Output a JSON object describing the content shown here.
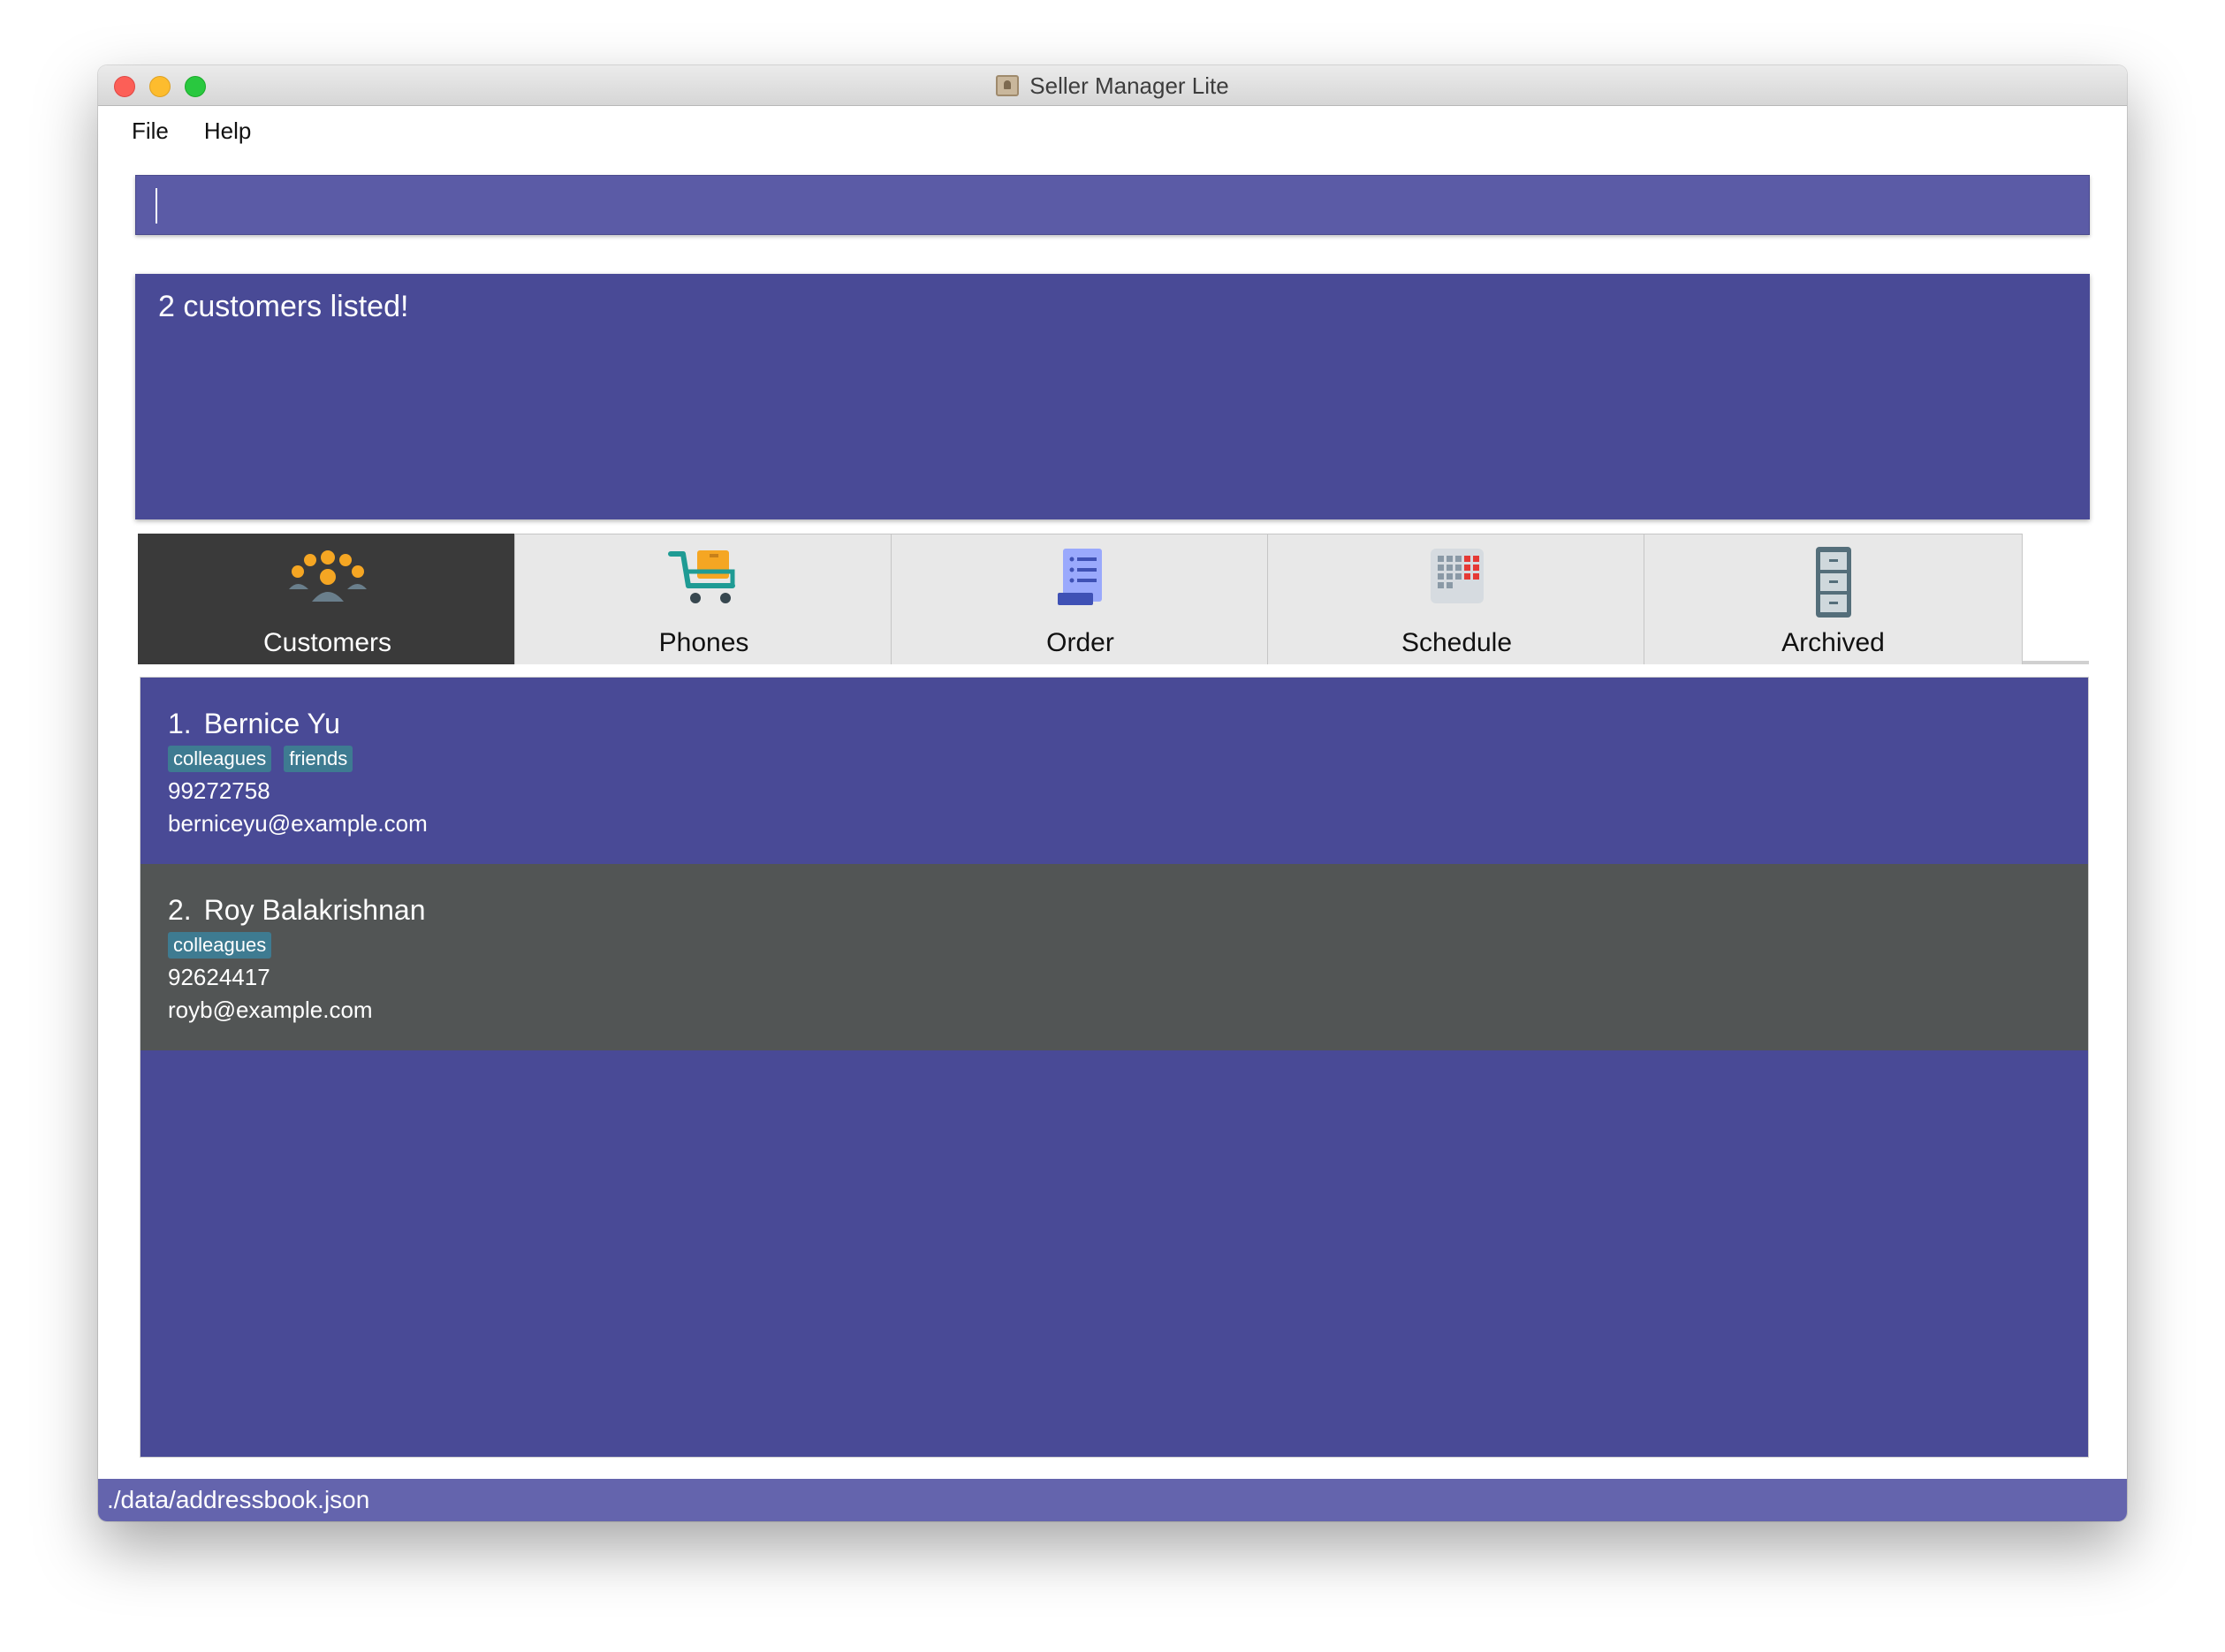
{
  "window": {
    "title": "Seller Manager Lite"
  },
  "menu": {
    "file": "File",
    "help": "Help"
  },
  "command": {
    "value": "",
    "placeholder": ""
  },
  "result": {
    "message": "2 customers listed!"
  },
  "tabs": [
    {
      "label": "Customers",
      "icon": "customers-icon",
      "active": true
    },
    {
      "label": "Phones",
      "icon": "shopping-cart-icon",
      "active": false
    },
    {
      "label": "Order",
      "icon": "order-list-icon",
      "active": false
    },
    {
      "label": "Schedule",
      "icon": "calendar-grid-icon",
      "active": false
    },
    {
      "label": "Archived",
      "icon": "file-cabinet-icon",
      "active": false
    }
  ],
  "customers": [
    {
      "index": "1.",
      "name": "Bernice Yu",
      "tags": [
        "colleagues",
        "friends"
      ],
      "phone": "99272758",
      "email": "berniceyu@example.com"
    },
    {
      "index": "2.",
      "name": "Roy Balakrishnan",
      "tags": [
        "colleagues"
      ],
      "phone": "92624417",
      "email": "royb@example.com"
    }
  ],
  "status": {
    "file_path": "./data/addressbook.json"
  },
  "colors": {
    "command_bg": "#5b5ba6",
    "result_bg": "#494a96",
    "list_bg": "#494a96",
    "card_alt_bg": "#525555",
    "tag_bg": "#3e7b91",
    "active_tab_bg": "#3a3a3a",
    "status_bg": "#6464ad"
  }
}
